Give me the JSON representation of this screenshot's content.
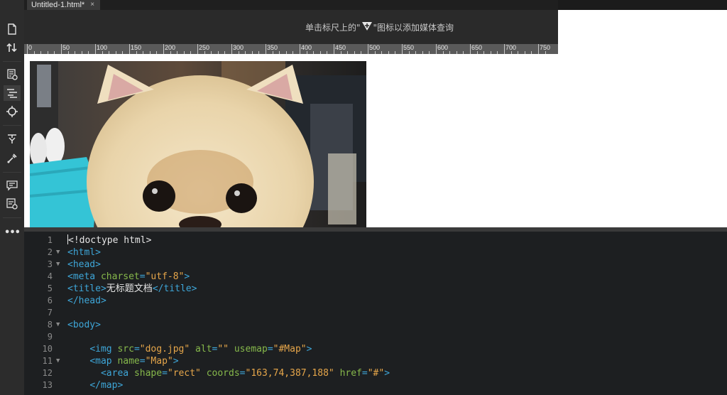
{
  "tab": {
    "title": "Untitled-1.html*",
    "close": "×"
  },
  "media_bar": {
    "prefix": "单击标尺上的\"",
    "suffix": "\"图标以添加媒体查询"
  },
  "ruler": {
    "labels": [
      "0",
      "50",
      "100",
      "150",
      "200",
      "250",
      "300",
      "350",
      "400",
      "450",
      "500",
      "550",
      "600",
      "650",
      "700",
      "750"
    ]
  },
  "toolbar": {
    "icons": [
      "new-document-icon",
      "file-transfer-icon",
      "live-view-icon",
      "code-navigator-icon",
      "target-icon",
      "code-tools-icon",
      "inspect-icon",
      "comment-icon",
      "validate-icon",
      "more-icon"
    ],
    "more_label": "•••"
  },
  "design_view": {
    "image_alt": "dog.jpg"
  },
  "code": {
    "lines": [
      {
        "num": "1",
        "fold": "",
        "parts": [
          {
            "c": "w",
            "t": "<!doctype html>"
          }
        ]
      },
      {
        "num": "2",
        "fold": "▼",
        "parts": [
          {
            "c": "t",
            "t": "<html>"
          }
        ]
      },
      {
        "num": "3",
        "fold": "▼",
        "parts": [
          {
            "c": "t",
            "t": "<head>"
          }
        ]
      },
      {
        "num": "4",
        "fold": "",
        "parts": [
          {
            "c": "t",
            "t": "<meta "
          },
          {
            "c": "a",
            "t": "charset"
          },
          {
            "c": "t",
            "t": "="
          },
          {
            "c": "s",
            "t": "\"utf-8\""
          },
          {
            "c": "t",
            "t": ">"
          }
        ]
      },
      {
        "num": "5",
        "fold": "",
        "parts": [
          {
            "c": "t",
            "t": "<title>"
          },
          {
            "c": "w",
            "t": "无标题文档"
          },
          {
            "c": "t",
            "t": "</title>"
          }
        ]
      },
      {
        "num": "6",
        "fold": "",
        "parts": [
          {
            "c": "t",
            "t": "</head>"
          }
        ]
      },
      {
        "num": "7",
        "fold": "",
        "parts": []
      },
      {
        "num": "8",
        "fold": "▼",
        "parts": [
          {
            "c": "t",
            "t": "<body>"
          }
        ]
      },
      {
        "num": "9",
        "fold": "",
        "parts": []
      },
      {
        "num": "10",
        "fold": "",
        "parts": [
          {
            "c": "w",
            "t": "    "
          },
          {
            "c": "t",
            "t": "<img "
          },
          {
            "c": "a",
            "t": "src"
          },
          {
            "c": "t",
            "t": "="
          },
          {
            "c": "s",
            "t": "\"dog.jpg\""
          },
          {
            "c": "t",
            "t": " "
          },
          {
            "c": "a",
            "t": "alt"
          },
          {
            "c": "t",
            "t": "="
          },
          {
            "c": "s",
            "t": "\"\""
          },
          {
            "c": "t",
            "t": " "
          },
          {
            "c": "a",
            "t": "usemap"
          },
          {
            "c": "t",
            "t": "="
          },
          {
            "c": "s",
            "t": "\"#Map\""
          },
          {
            "c": "t",
            "t": ">"
          }
        ]
      },
      {
        "num": "11",
        "fold": "▼",
        "parts": [
          {
            "c": "w",
            "t": "    "
          },
          {
            "c": "t",
            "t": "<map "
          },
          {
            "c": "a",
            "t": "name"
          },
          {
            "c": "t",
            "t": "="
          },
          {
            "c": "s",
            "t": "\"Map\""
          },
          {
            "c": "t",
            "t": ">"
          }
        ]
      },
      {
        "num": "12",
        "fold": "",
        "parts": [
          {
            "c": "w",
            "t": "      "
          },
          {
            "c": "t",
            "t": "<area "
          },
          {
            "c": "a",
            "t": "shape"
          },
          {
            "c": "t",
            "t": "="
          },
          {
            "c": "s",
            "t": "\"rect\""
          },
          {
            "c": "t",
            "t": " "
          },
          {
            "c": "a",
            "t": "coords"
          },
          {
            "c": "t",
            "t": "="
          },
          {
            "c": "s",
            "t": "\"163,74,387,188\""
          },
          {
            "c": "t",
            "t": " "
          },
          {
            "c": "a",
            "t": "href"
          },
          {
            "c": "t",
            "t": "="
          },
          {
            "c": "s",
            "t": "\"#\""
          },
          {
            "c": "t",
            "t": ">"
          }
        ]
      },
      {
        "num": "13",
        "fold": "",
        "parts": [
          {
            "c": "w",
            "t": "    "
          },
          {
            "c": "t",
            "t": "</map>"
          }
        ]
      }
    ]
  }
}
